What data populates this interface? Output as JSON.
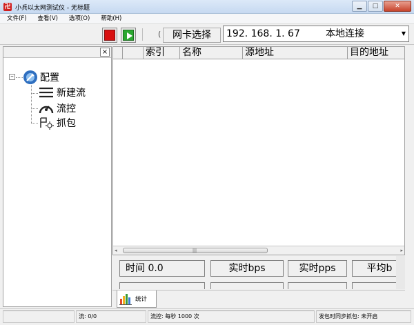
{
  "window": {
    "title": "小兵以太网测试仪 - 无标题"
  },
  "menu": [
    "文件(F)",
    "查看(V)",
    "选项(O)",
    "帮助(H)"
  ],
  "toolbar": {
    "nic_label": "网卡选择",
    "nic_ip": "192. 168. 1. 67",
    "nic_connection": "本地连接"
  },
  "left_panel": {
    "close": "×",
    "tree": {
      "root": "配置",
      "children": [
        "新建流",
        "流控",
        "抓包"
      ]
    }
  },
  "grid": {
    "columns": [
      "",
      "索引",
      "名称",
      "源地址",
      "目的地址"
    ]
  },
  "stats": {
    "time_label": "时间 0.0",
    "realtime_bps": "实时bps",
    "realtime_pps": "实时pps",
    "avg": "平均b"
  },
  "tabs": [
    {
      "label": "统计"
    }
  ],
  "status": {
    "flow": "流: 0/0",
    "flow_control": "流控: 每秒 1000 次",
    "sync_capture": "发包时同步抓包: 未开启"
  },
  "colors": {
    "stop": "#d81010",
    "play": "#2aa830",
    "accent": "#3a7bd5"
  }
}
